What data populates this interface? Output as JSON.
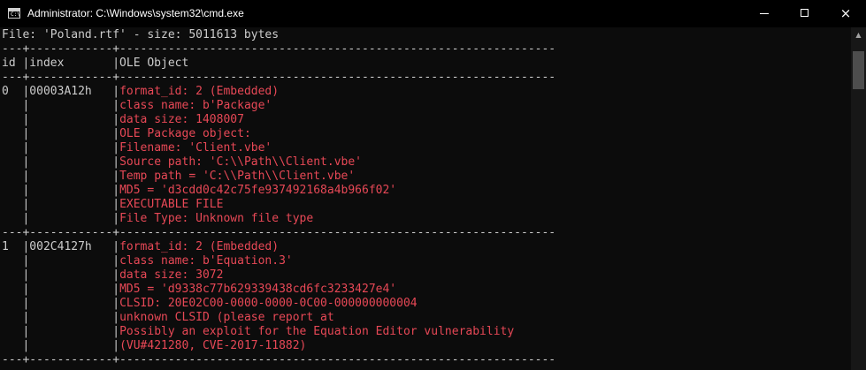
{
  "window": {
    "title": "Administrator: C:\\Windows\\system32\\cmd.exe",
    "icon_text": "C:\\",
    "controls": {
      "minimize": "minimize-icon",
      "maximize": "maximize-icon",
      "close": "×"
    }
  },
  "colors": {
    "background": "#0c0c0c",
    "text": "#cccccc",
    "highlight": "#e74856",
    "titlebar": "#000000"
  },
  "console": {
    "lines": [
      {
        "text": "File: 'Poland.rtf' - size: 5011613 bytes",
        "type": "normal"
      },
      {
        "text": "---+------------+---------------------------------------------------------------",
        "type": "sep"
      },
      {
        "text": "id |index       |OLE Object",
        "type": "normal"
      },
      {
        "text": "---+------------+---------------------------------------------------------------",
        "type": "sep"
      },
      {
        "text": "0  |00003A12h   |",
        "type": "row",
        "red": "format_id: 2 (Embedded)"
      },
      {
        "text": "   |            |",
        "type": "row",
        "red": "class name: b'Package'"
      },
      {
        "text": "   |            |",
        "type": "row",
        "red": "data size: 1408007"
      },
      {
        "text": "   |            |",
        "type": "row",
        "red": "OLE Package object:"
      },
      {
        "text": "   |            |",
        "type": "row",
        "red": "Filename: 'Client.vbe'"
      },
      {
        "text": "   |            |",
        "type": "row",
        "red": "Source path: 'C:\\\\Path\\\\Client.vbe'"
      },
      {
        "text": "   |            |",
        "type": "row",
        "red": "Temp path = 'C:\\\\Path\\\\Client.vbe'"
      },
      {
        "text": "   |            |",
        "type": "row",
        "red": "MD5 = 'd3cdd0c42c75fe937492168a4b966f02'"
      },
      {
        "text": "   |            |",
        "type": "row",
        "red": "EXECUTABLE FILE"
      },
      {
        "text": "   |            |",
        "type": "row",
        "red": "File Type: Unknown file type"
      },
      {
        "text": "---+------------+---------------------------------------------------------------",
        "type": "sep"
      },
      {
        "text": "1  |002C4127h   |",
        "type": "row",
        "red": "format_id: 2 (Embedded)"
      },
      {
        "text": "   |            |",
        "type": "row",
        "red": "class name: b'Equation.3'"
      },
      {
        "text": "   |            |",
        "type": "row",
        "red": "data size: 3072"
      },
      {
        "text": "   |            |",
        "type": "row",
        "red": "MD5 = 'd9338c77b629339438cd6fc3233427e4'"
      },
      {
        "text": "   |            |",
        "type": "row",
        "red": "CLSID: 20E02C00-0000-0000-0C00-000000000004"
      },
      {
        "text": "   |            |",
        "type": "row",
        "red": "unknown CLSID (please report at"
      },
      {
        "text": "   |            |",
        "type": "row",
        "red": "Possibly an exploit for the Equation Editor vulnerability"
      },
      {
        "text": "   |            |",
        "type": "row",
        "red": "(VU#421280, CVE-2017-11882)"
      },
      {
        "text": "---+------------+---------------------------------------------------------------",
        "type": "sep"
      }
    ]
  },
  "scrollbar": {
    "up_arrow": "▲"
  }
}
